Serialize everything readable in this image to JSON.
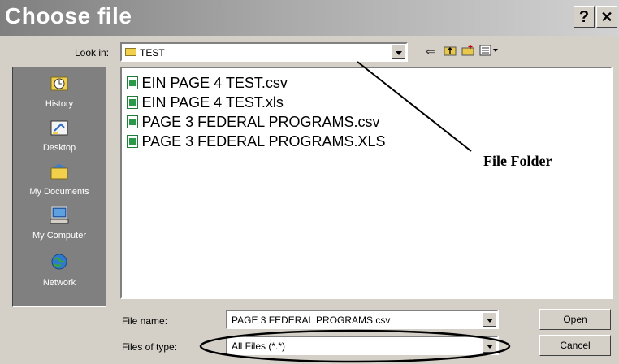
{
  "window": {
    "title": "Choose file",
    "help_label": "?",
    "close_label": "✕"
  },
  "lookin": {
    "label": "Look in:",
    "value": "TEST",
    "toolbar_icons": [
      "back-arrow-icon",
      "up-folder-icon",
      "new-folder-icon",
      "view-menu-icon"
    ]
  },
  "places": [
    {
      "label": "History",
      "icon": "history-icon"
    },
    {
      "label": "Desktop",
      "icon": "desktop-icon"
    },
    {
      "label": "My Documents",
      "icon": "my-documents-icon"
    },
    {
      "label": "My Computer",
      "icon": "my-computer-icon"
    },
    {
      "label": "Network",
      "icon": "network-icon"
    }
  ],
  "files": [
    {
      "name": "EIN PAGE 4 TEST.csv"
    },
    {
      "name": "EIN PAGE 4 TEST.xls"
    },
    {
      "name": "PAGE 3 FEDERAL PROGRAMS.csv"
    },
    {
      "name": "PAGE 3 FEDERAL PROGRAMS.XLS"
    }
  ],
  "annotation": "File Folder",
  "filename": {
    "label": "File name:",
    "value": "PAGE 3 FEDERAL PROGRAMS.csv"
  },
  "filetype": {
    "label": "Files of type:",
    "value": "All Files (*.*)"
  },
  "buttons": {
    "open": "Open",
    "cancel": "Cancel"
  },
  "colors": {
    "title_gradient_start": "#7f7f7f",
    "title_gradient_end": "#d2d2d2",
    "dialog_bg": "#d4d0c8",
    "places_bg": "#808080"
  }
}
